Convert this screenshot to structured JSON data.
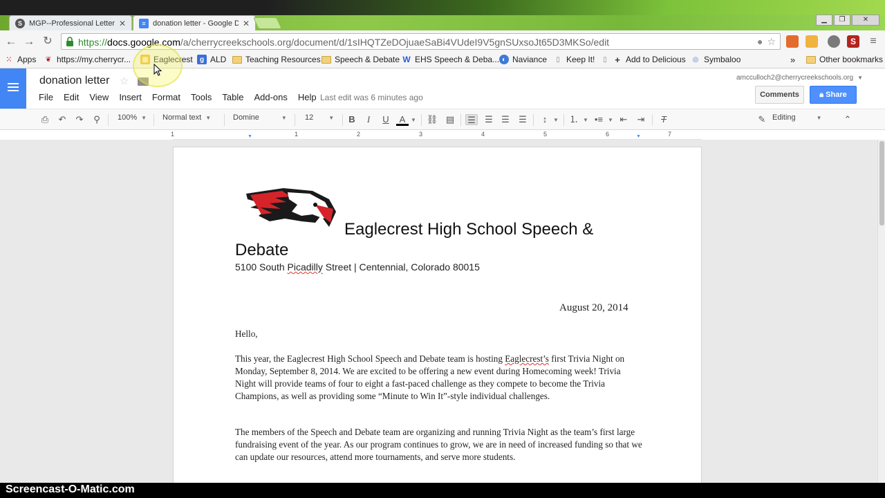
{
  "browser": {
    "tabs": [
      {
        "label": "MGP--Professional Letter",
        "state": "inactive"
      },
      {
        "label": "donation letter - Google D",
        "state": "active"
      }
    ],
    "url_scheme": "https://",
    "url_host": "docs.google.com",
    "url_path": "/a/cherrycreekschools.org/document/d/1sIHQTZeDOjuaeSaBi4VUdeI9V5gnSUxsoJt65D3MKSo/edit",
    "bookmarks": [
      {
        "label": "Apps",
        "icon": "apps-grid-icon"
      },
      {
        "label": "https://my.cherrycr...",
        "icon": "eagle-icon"
      },
      {
        "label": "Eaglecrest",
        "icon": "calendar-icon"
      },
      {
        "label": "ALD",
        "icon": "google-plus-icon"
      },
      {
        "label": "Teaching Resources",
        "icon": "folder-icon"
      },
      {
        "label": "Speech & Debate",
        "icon": "folder-icon"
      },
      {
        "label": "EHS Speech & Deba...",
        "icon": "w-logo-icon"
      },
      {
        "label": "Naviance",
        "icon": "naviance-icon"
      },
      {
        "label": "Keep It!",
        "icon": "page-icon"
      },
      {
        "label": "",
        "icon": "page-icon"
      },
      {
        "label": "Add to Delicious",
        "icon": "plus-icon"
      },
      {
        "label": "Symbaloo",
        "icon": "symbaloo-icon"
      }
    ],
    "overflow": "»",
    "other_bookmarks": "Other bookmarks"
  },
  "docs": {
    "title": "donation letter",
    "menu": [
      "File",
      "Edit",
      "View",
      "Insert",
      "Format",
      "Tools",
      "Table",
      "Add-ons",
      "Help"
    ],
    "last_edit": "Last edit was 6 minutes ago",
    "account": "amcculloch2@cherrycreekschools.org",
    "comments_label": "Comments",
    "share_label": "Share",
    "toolbar": {
      "zoom": "100%",
      "style": "Normal text",
      "font": "Domine",
      "size": "12",
      "mode": "Editing"
    },
    "ruler_numbers": [
      "1",
      "1",
      "2",
      "3",
      "4",
      "5",
      "6",
      "7"
    ]
  },
  "document": {
    "heading_line1": "Eaglecrest High School Speech &",
    "heading_line2": "Debate",
    "address_pre": "5100 South ",
    "address_spell": "Picadilly",
    "address_post": " Street | Centennial, Colorado 80015",
    "date": "August 20, 2014",
    "greeting": "Hello,",
    "para1_pre": "This year, the Eaglecrest High School Speech and Debate team is hosting ",
    "para1_spell": "Eaglecrest’s",
    "para1_post": " first Trivia Night on Monday, September 8, 2014.  We are excited to be offering a new event during Homecoming week!  Trivia Night will provide teams of four to eight a fast-paced challenge as they compete to become the Trivia Champions, as well as providing some “Minute to Win It”-style individual challenges.",
    "para2": "The members of the Speech and Debate team are organizing and running Trivia Night as the team’s first large fundraising event of the year.  As our program continues to grow, we are in need of increased funding so that we can update our resources, attend more tournaments, and serve more students."
  },
  "watermark": "Screencast-O-Matic.com",
  "colors": {
    "docs_blue": "#4285f4",
    "share_blue": "#4d90fe",
    "spellcheck_red": "#e03232"
  }
}
